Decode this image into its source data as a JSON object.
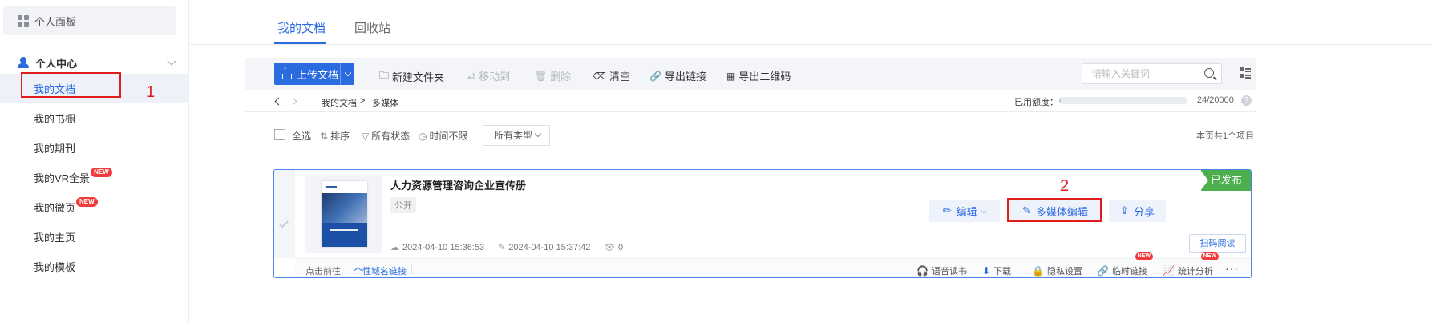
{
  "sidebar": {
    "panel_label": "个人面板",
    "group_label": "个人中心",
    "items": [
      {
        "label": "我的文档",
        "badge": ""
      },
      {
        "label": "我的书橱",
        "badge": ""
      },
      {
        "label": "我的期刊",
        "badge": ""
      },
      {
        "label": "我的VR全景",
        "badge": "NEW"
      },
      {
        "label": "我的微页",
        "badge": "NEW"
      },
      {
        "label": "我的主页",
        "badge": ""
      },
      {
        "label": "我的模板",
        "badge": ""
      }
    ],
    "annotation_number": "1"
  },
  "tabs": [
    {
      "label": "我的文档",
      "active": true
    },
    {
      "label": "回收站",
      "active": false
    }
  ],
  "toolbar": {
    "upload": "上传文档",
    "new_folder": "新建文件夹",
    "move_to": "移动到",
    "delete": "删除",
    "clear": "清空",
    "export_link": "导出链接",
    "export_qr": "导出二维码",
    "search_placeholder": "请输入关键词"
  },
  "breadcrumb": {
    "root": "我的文档",
    "separator": ">",
    "current": "多媒体"
  },
  "quota": {
    "label": "已用额度：",
    "text": "24/20000",
    "used_fraction": 0.0012
  },
  "filters": {
    "select_all": "全选",
    "sort": "排序",
    "status": "所有状态",
    "time": "时间不限",
    "type": "所有类型",
    "page_count": "本页共1个项目"
  },
  "document": {
    "title": "人力资源管理咨询企业宣传册",
    "visibility": "公开",
    "status": "已发布",
    "created": "2024-04-10 15:36:53",
    "modified": "2024-04-10 15:37:42",
    "views": "0",
    "edit": "编辑",
    "media_edit": "多媒体编辑",
    "share": "分享",
    "scan_read": "扫码阅读",
    "annotation_number": "2",
    "footer": {
      "goto_label": "点击前往:",
      "domain_link": "个性域名链接",
      "voice": "语音读书",
      "download": "下载",
      "privacy": "隐私设置",
      "temp_link": "临时链接",
      "stats": "统计分析",
      "new_badge": "NEW"
    }
  },
  "colors": {
    "accent": "#2b6be0",
    "annotation": "#e01d1d",
    "published": "#4cae4c",
    "badge": "#f23a3a"
  }
}
